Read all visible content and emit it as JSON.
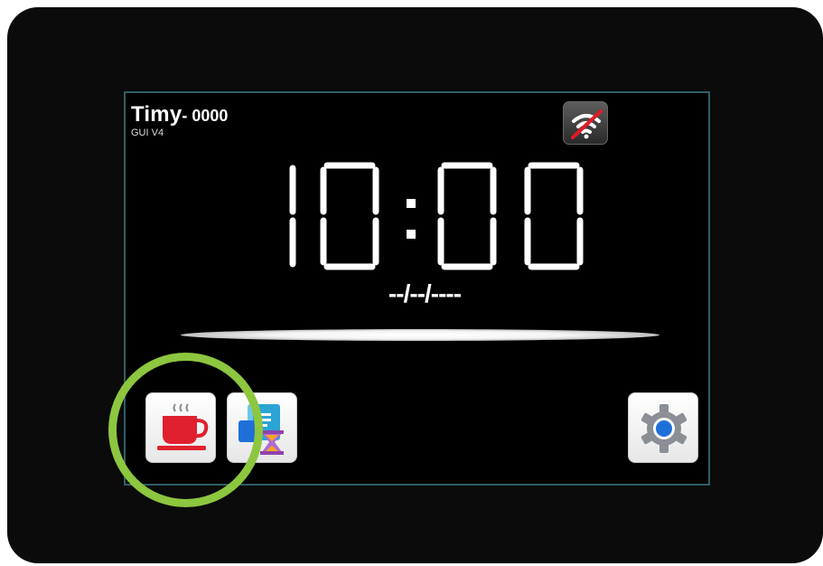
{
  "header": {
    "name": "Timy",
    "device_id": "- 0000",
    "version": "GUI V4"
  },
  "clock": {
    "time": "10:00",
    "date": "--/--/----"
  },
  "status": {
    "wifi_icon": "wifi-off-icon"
  },
  "buttons": [
    {
      "icon": "coffee-cup-icon"
    },
    {
      "icon": "schedule-hourglass-icon"
    },
    {
      "icon": "gear-icon"
    }
  ],
  "colors": {
    "highlight": "#8dc63f",
    "accent_blue": "#1e6fd8",
    "cup_red": "#e0202e"
  }
}
